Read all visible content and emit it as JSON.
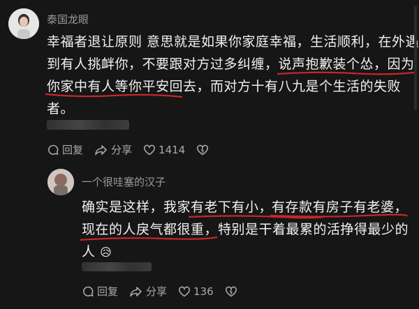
{
  "comment1": {
    "username": "泰国龙眼",
    "line1": "幸福者退让原则 意思就是如果你家庭幸福，生活顺利，在外遇",
    "line2_a": "到有人挑衅你，不要跟对方过多纠缠，",
    "line2_b": "说声抱歉装个怂，因为",
    "line3_a": "你家中有人等你平安回去",
    "line3_b": "，而对方十有八九是个生活的失败",
    "line4": "者。",
    "reply_label": "回复",
    "share_label": "分享",
    "like_count": "1414"
  },
  "comment2": {
    "username": "一个很哇塞的汉子",
    "line1_a": "确实是这样，我家有老下有小，",
    "line1_b": "有存款有房子有老婆，",
    "line2_a": "现在的人戾气都很重",
    "line2_b": "，特别是干着最累的活挣得最少的",
    "line3": "人",
    "emoji": "😥",
    "reply_label": "回复",
    "share_label": "分享",
    "like_count": "136"
  },
  "colors": {
    "underline": "#c8262b",
    "background": "#161616",
    "muted": "#9a9a9a"
  },
  "icons": [
    "reply-icon",
    "share-icon",
    "heart-icon",
    "dislike-heart-icon"
  ]
}
